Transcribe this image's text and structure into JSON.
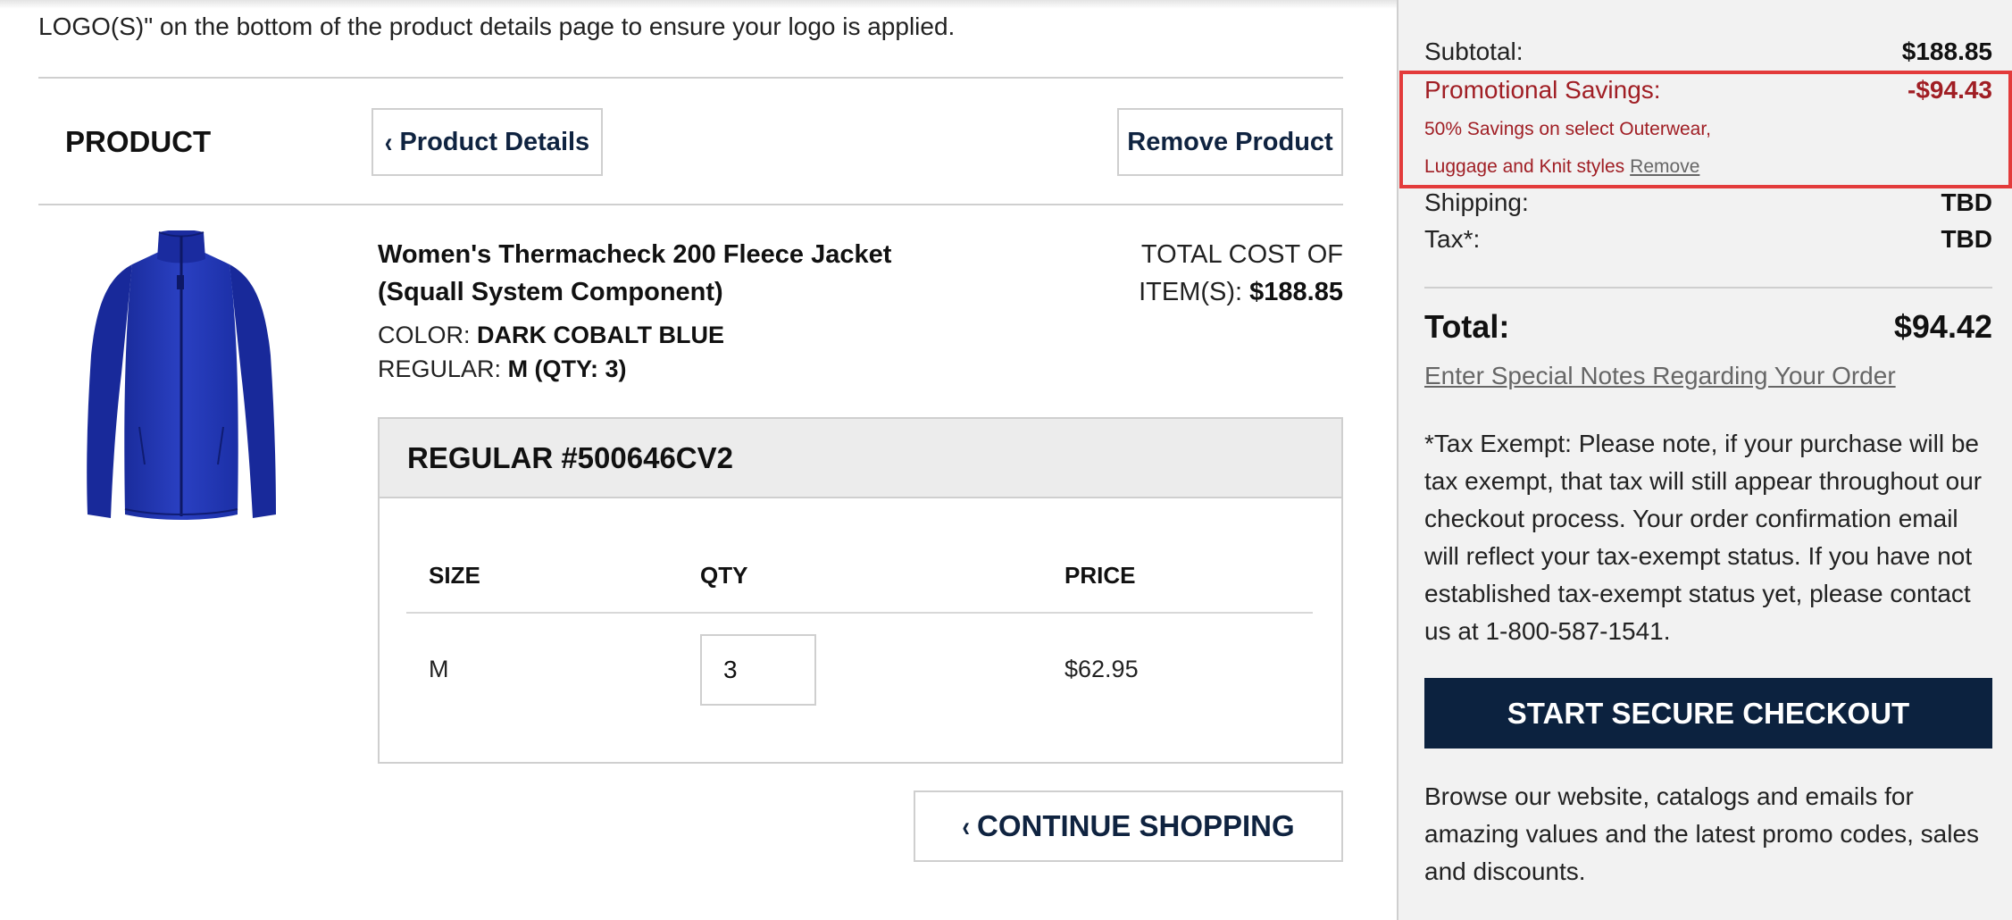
{
  "notice": {
    "text": "LOGO(S)\" on the bottom of the product details page to ensure your logo is applied."
  },
  "product_header": {
    "heading": "PRODUCT",
    "details_button": "Product Details",
    "remove_button": "Remove Product"
  },
  "item": {
    "name": "Women's Thermacheck 200 Fleece Jacket (Squall System Component)",
    "color_label": "COLOR:",
    "color_value": "DARK COBALT BLUE",
    "regular_label": "REGULAR:",
    "regular_value": "M (QTY: 3)",
    "total_cost_label": "TOTAL COST OF ITEM(S):",
    "total_cost_value": "$188.85",
    "image_color": "#1f36b5"
  },
  "sku_table": {
    "title": "REGULAR #500646CV2",
    "headers": {
      "size": "SIZE",
      "qty": "QTY",
      "price": "PRICE"
    },
    "rows": [
      {
        "size": "M",
        "qty": "3",
        "price": "$62.95"
      }
    ]
  },
  "continue_button": "CONTINUE SHOPPING",
  "summary": {
    "subtotal_label": "Subtotal:",
    "subtotal_value": "$188.85",
    "promo_label": "Promotional Savings:",
    "promo_value": "-$94.43",
    "promo_desc_line1": "50% Savings on select Outerwear,",
    "promo_desc_line2": "Luggage and Knit styles",
    "promo_remove": "Remove",
    "shipping_label": "Shipping:",
    "shipping_value": "TBD",
    "tax_label": "Tax*:",
    "tax_value": "TBD",
    "total_label": "Total:",
    "total_value": "$94.42",
    "notes_link": "Enter Special Notes Regarding Your Order",
    "tax_note": "*Tax Exempt: Please note, if your purchase will be tax exempt, that tax will still appear throughout our checkout process. Your order confirmation email will reflect your tax-exempt status. If you have not established tax-exempt status yet, please contact us at 1-800-587-1541.",
    "checkout_button": "START SECURE CHECKOUT",
    "browse_note": "Browse our website, catalogs and emails for amazing values and the latest promo codes, sales and discounts."
  },
  "colors": {
    "navy": "#0c223f",
    "promo_red": "#a01e24",
    "highlight_red": "#e33b3b",
    "sidebar_bg": "#f2f2f2"
  }
}
